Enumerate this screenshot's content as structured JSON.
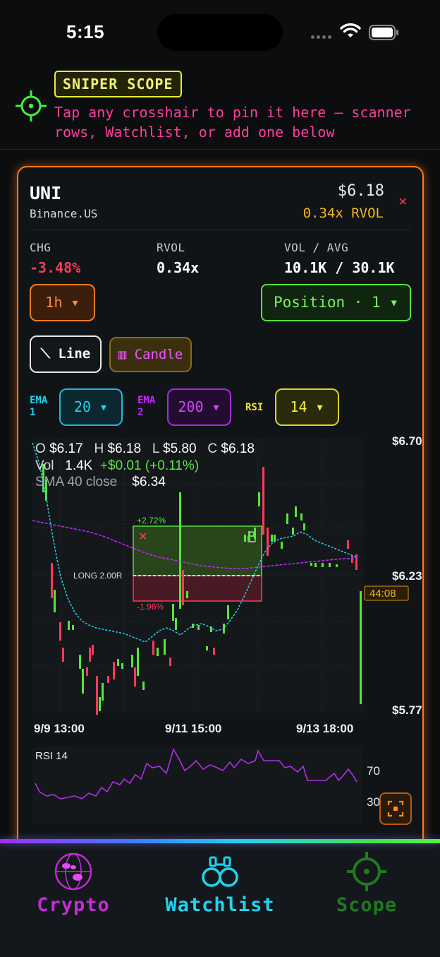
{
  "status_bar": {
    "time": "5:15"
  },
  "scope": {
    "badge": "SNIPER SCOPE",
    "hint": "Tap any crosshair to pin it here — scanner rows, Watchlist, or add one below"
  },
  "card": {
    "symbol": "UNI",
    "exchange": "Binance.US",
    "price": "$6.18",
    "rvol_badge": "0.34x RVOL",
    "close": "×",
    "stats": {
      "chg_label": "CHG",
      "chg_value": "-3.48%",
      "rvol_label": "RVOL",
      "rvol_value": "0.34x",
      "vol_label": "VOL / AVG",
      "vol_value": "10.1K / 30.1K"
    },
    "timeframe_button": "1h ▾",
    "position_button": "Position · 1 ▾",
    "line_button": "⟍ Line",
    "candle_button": "▥ Candle",
    "ema1": {
      "label_line1": "EMA",
      "label_line2": "1",
      "value": "20 ▾"
    },
    "ema2": {
      "label_line1": "EMA",
      "label_line2": "2",
      "value": "200 ▾"
    },
    "rsi": {
      "label": "RSI",
      "value": "14 ▾"
    }
  },
  "chart": {
    "ohlc": {
      "o_label": "O",
      "o": "$6.17",
      "h_label": "H",
      "h": "$6.18",
      "l_label": "L",
      "l": "$5.80",
      "c_label": "C",
      "c": "$6.18",
      "vol_label": "Vol",
      "vol": "1.4K",
      "change": "+$0.01 (+0.11%)",
      "sma_label": "SMA 40 close",
      "sma": "$6.34"
    },
    "y_labels": {
      "top": "$6.70",
      "mid": "$6.23",
      "bottom": "$5.77"
    },
    "countdown": "44:08",
    "x_labels": [
      "9/9 13:00",
      "9/11 15:00",
      "9/13 18:00"
    ],
    "position": {
      "tp_pct": "+2.72%",
      "sl_pct": "-1.96%",
      "label": "LONG 2.00R"
    },
    "rsi_panel": {
      "title": "RSI 14",
      "level_high": "70",
      "level_low": "30"
    },
    "colors": {
      "up": "#55e63a",
      "down": "#ff3b57",
      "ema1": "#22d3ee",
      "ema2": "#c02bff"
    }
  },
  "tabs": [
    {
      "label": "Crypto",
      "icon": "globe-icon",
      "color": "#c42bd6"
    },
    {
      "label": "Watchlist",
      "icon": "binoculars-icon",
      "color": "#22d3ee"
    },
    {
      "label": "Scope",
      "icon": "crosshair-icon",
      "color": "#1f7a1f"
    }
  ]
}
